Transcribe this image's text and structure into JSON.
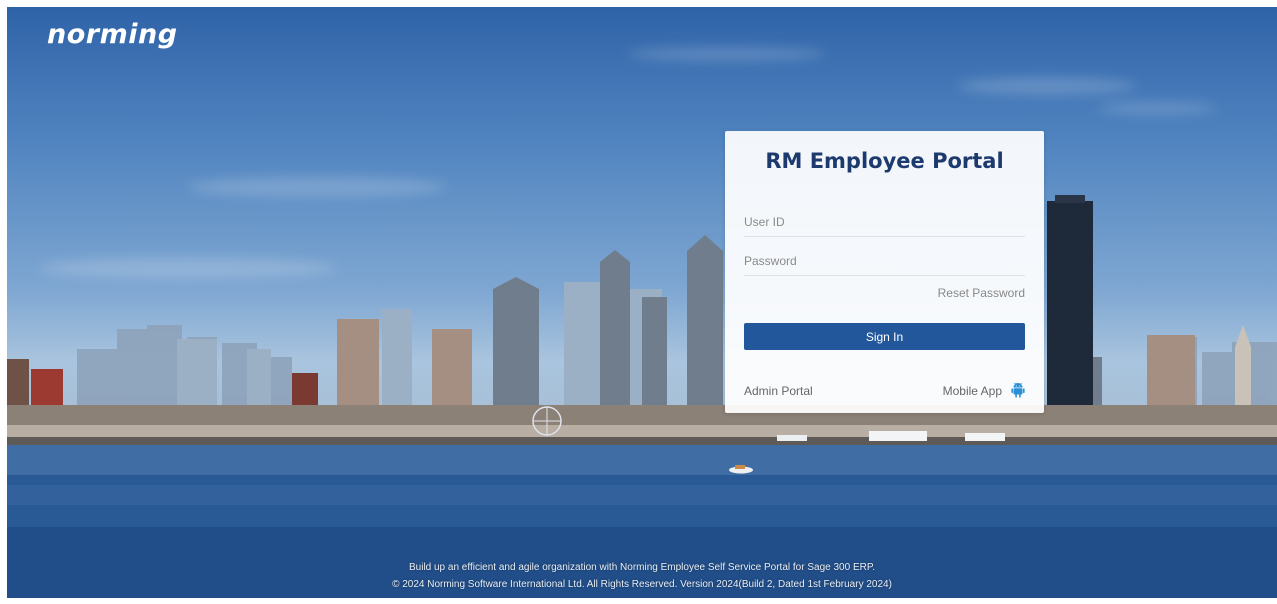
{
  "brand": {
    "logo_text": "norming"
  },
  "login": {
    "title": "RM Employee Portal",
    "user_id_placeholder": "User ID",
    "password_placeholder": "Password",
    "reset_password_label": "Reset Password",
    "sign_in_label": "Sign In",
    "admin_portal_label": "Admin Portal",
    "mobile_app_label": "Mobile App",
    "mobile_icon": "android-icon"
  },
  "footer": {
    "tagline": "Build up an efficient and agile organization with Norming Employee Self Service Portal for Sage 300 ERP.",
    "copyright": "© 2024 Norming Software International Ltd. All Rights Reserved. Version 2024(Build 2, Dated 1st February 2024)"
  },
  "colors": {
    "primary_button": "#23579b",
    "title_text": "#1d3a6e",
    "android_icon": "#2a8fd6"
  }
}
